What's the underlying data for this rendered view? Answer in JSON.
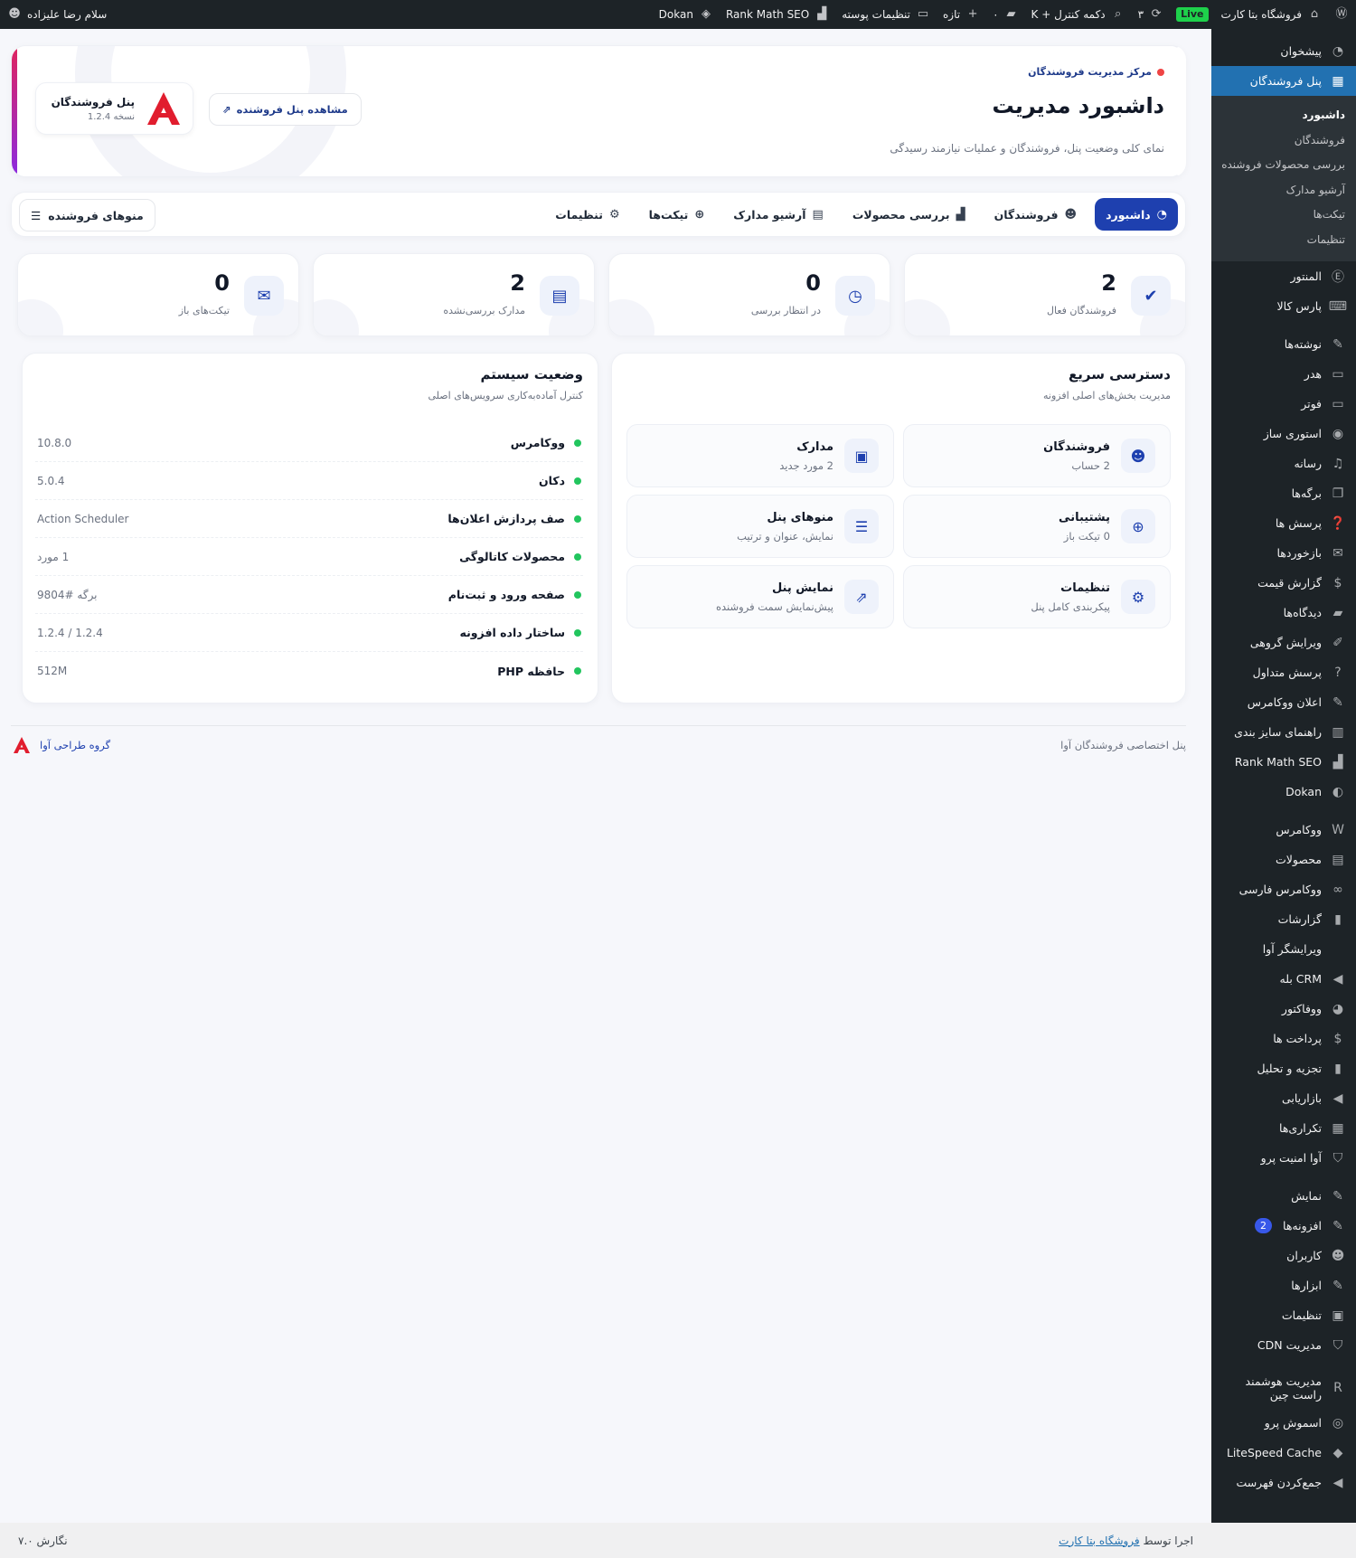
{
  "adminbar": {
    "site_name": "فروشگاه بتا کارت",
    "live_badge": "Live",
    "updates_count": "۳",
    "shortcut": "دکمه کنترل + K",
    "comments_count": "۰",
    "new_label": "تازه",
    "skin_settings": "تنظیمات پوسته",
    "rankmath": "Rank Math SEO",
    "dokan": "Dokan",
    "greeting": "سلام رضا علیزاده"
  },
  "sidebar": {
    "items_top": [
      {
        "label": "پیشخوان",
        "icon": "dashboard-icon",
        "glyph": "◔"
      },
      {
        "label": "پنل فروشندگان",
        "icon": "store-icon",
        "glyph": "▦"
      }
    ],
    "submenu": [
      "داشبورد",
      "فروشندگان",
      "بررسی محصولات فروشنده",
      "آرشیو مدارک",
      "تیکت‌ها",
      "تنظیمات"
    ],
    "items": [
      {
        "label": "المنتور",
        "icon": "elementor-icon",
        "glyph": "Ⓔ",
        "sep": false
      },
      {
        "label": "پارس کالا",
        "icon": "pars-kala-icon",
        "glyph": "⌨",
        "sep": false
      },
      {
        "label": "نوشته‌ها",
        "icon": "pin-icon",
        "glyph": "✎",
        "sep": true
      },
      {
        "label": "هدر",
        "icon": "header-icon",
        "glyph": "▭",
        "sep": false
      },
      {
        "label": "فوتر",
        "icon": "footer-icon",
        "glyph": "▭",
        "sep": false
      },
      {
        "label": "استوری ساز",
        "icon": "story-icon",
        "glyph": "◉",
        "sep": false
      },
      {
        "label": "رسانه",
        "icon": "media-icon",
        "glyph": "♫",
        "sep": false
      },
      {
        "label": "برگه‌ها",
        "icon": "pages-icon",
        "glyph": "❐",
        "sep": false
      },
      {
        "label": "پرسش ها",
        "icon": "questions-icon",
        "glyph": "❓",
        "sep": false
      },
      {
        "label": "بازخوردها",
        "icon": "feedback-icon",
        "glyph": "✉",
        "sep": false
      },
      {
        "label": "گزارش قیمت",
        "icon": "price-report-icon",
        "glyph": "$",
        "sep": false
      },
      {
        "label": "دیدگاه‌ها",
        "icon": "comments-icon",
        "glyph": "▰",
        "sep": false
      },
      {
        "label": "ویرایش گروهی",
        "icon": "bulk-edit-icon",
        "glyph": "✐",
        "sep": false
      },
      {
        "label": "پرسش متداول",
        "icon": "faq-icon",
        "glyph": "?",
        "sep": false
      },
      {
        "label": "اعلان ووکامرس",
        "icon": "notify-icon",
        "glyph": "✎",
        "sep": false
      },
      {
        "label": "راهنمای سایز بندی",
        "icon": "size-guide-icon",
        "glyph": "▥",
        "sep": false
      },
      {
        "label": "Rank Math SEO",
        "icon": "rankmath-icon",
        "glyph": "▟",
        "sep": false
      },
      {
        "label": "Dokan",
        "icon": "dokan-icon",
        "glyph": "◐",
        "sep": false
      },
      {
        "label": "ووکامرس",
        "icon": "woocommerce-icon",
        "glyph": "W",
        "sep": true
      },
      {
        "label": "محصولات",
        "icon": "products-icon",
        "glyph": "▤",
        "sep": false
      },
      {
        "label": "ووکامرس فارسی",
        "icon": "woo-persian-icon",
        "glyph": "∞",
        "sep": false
      },
      {
        "label": "گزارشات",
        "icon": "reports-icon",
        "glyph": "▮",
        "sep": false
      },
      {
        "label": "ویرایشگر آوا",
        "icon": "ava-editor-icon",
        "glyph": "",
        "sep": false
      },
      {
        "label": "CRM بله",
        "icon": "crm-icon",
        "glyph": "◀",
        "sep": false
      },
      {
        "label": "ووفاکتور",
        "icon": "woofactor-icon",
        "glyph": "◕",
        "sep": false
      },
      {
        "label": "پرداخت ها",
        "icon": "payments-icon",
        "glyph": "$",
        "sep": false
      },
      {
        "label": "تجزیه و تحلیل",
        "icon": "analytics-icon",
        "glyph": "▮",
        "sep": false
      },
      {
        "label": "بازاریابی",
        "icon": "marketing-icon",
        "glyph": "◀",
        "sep": false
      },
      {
        "label": "تکراری‌ها",
        "icon": "duplicates-icon",
        "glyph": "▦",
        "sep": false
      },
      {
        "label": "آوا امنیت پرو",
        "icon": "security-icon",
        "glyph": "⛉",
        "sep": false
      },
      {
        "label": "نمایش",
        "icon": "appearance-icon",
        "glyph": "✎",
        "sep": true
      },
      {
        "label": "افزونه‌ها",
        "icon": "plugins-icon",
        "glyph": "✎",
        "sep": false,
        "badge": "2"
      },
      {
        "label": "کاربران",
        "icon": "users-icon",
        "glyph": "☻",
        "sep": false
      },
      {
        "label": "ابزارها",
        "icon": "tools-icon",
        "glyph": "✎",
        "sep": false
      },
      {
        "label": "تنظیمات",
        "icon": "settings-icon",
        "glyph": "▣",
        "sep": false
      },
      {
        "label": "مدیریت CDN",
        "icon": "cdn-icon",
        "glyph": "⛉",
        "sep": false
      },
      {
        "label": "مدیریت هوشمند راست چین",
        "icon": "rtl-theme-icon",
        "glyph": "R",
        "sep": true
      },
      {
        "label": "اسموش پرو",
        "icon": "smush-icon",
        "glyph": "◎",
        "sep": false
      },
      {
        "label": "LiteSpeed Cache",
        "icon": "litespeed-icon",
        "glyph": "◆",
        "sep": false
      },
      {
        "label": "جمع‌کردن فهرست",
        "icon": "collapse-icon",
        "glyph": "◀",
        "sep": false
      }
    ]
  },
  "hero": {
    "crumb": "مرکز مدیریت فروشندگان",
    "title": "داشبورد مدیریت",
    "desc": "نمای کلی وضعیت پنل، فروشندگان و عملیات نیازمند رسیدگی",
    "view_panel": "مشاهده پنل فروشنده",
    "brand_name": "پنل فروشندگان",
    "brand_version": "نسخه 1.2.4"
  },
  "tabs": [
    {
      "label": "داشبورد",
      "icon": "dashboard-icon",
      "glyph": "◔",
      "active": true
    },
    {
      "label": "فروشندگان",
      "icon": "users-icon",
      "glyph": "☻",
      "active": false
    },
    {
      "label": "بررسی محصولات",
      "icon": "bag-icon",
      "glyph": "▟",
      "active": false
    },
    {
      "label": "آرشیو مدارک",
      "icon": "archive-icon",
      "glyph": "▤",
      "active": false
    },
    {
      "label": "تیکت‌ها",
      "icon": "lifebuoy-icon",
      "glyph": "⊕",
      "active": false
    },
    {
      "label": "تنظیمات",
      "icon": "gear-icon",
      "glyph": "⚙",
      "active": false
    }
  ],
  "vendor_menus": "منوهای فروشنده",
  "stats": [
    {
      "value": "2",
      "label": "فروشندگان فعال",
      "icon": "check-icon",
      "glyph": "✔"
    },
    {
      "value": "0",
      "label": "در انتظار بررسی",
      "icon": "clock-icon",
      "glyph": "◷"
    },
    {
      "value": "2",
      "label": "مدارک بررسی‌نشده",
      "icon": "document-icon",
      "glyph": "▤"
    },
    {
      "value": "0",
      "label": "تیکت‌های باز",
      "icon": "chat-icon",
      "glyph": "✉"
    }
  ],
  "quick_access": {
    "title": "دسترسی سریع",
    "subtitle": "مدیریت بخش‌های اصلی افزونه",
    "items": [
      {
        "title": "فروشندگان",
        "sub": "2 حساب",
        "icon": "users-icon",
        "glyph": "☻"
      },
      {
        "title": "مدارک",
        "sub": "2 مورد جدید",
        "icon": "id-card-icon",
        "glyph": "▣"
      },
      {
        "title": "پشتیبانی",
        "sub": "0 تیکت باز",
        "icon": "lifebuoy-icon",
        "glyph": "⊕"
      },
      {
        "title": "منوهای پنل",
        "sub": "نمایش، عنوان و ترتیب",
        "icon": "menu-icon",
        "glyph": "☰"
      },
      {
        "title": "تنظیمات",
        "sub": "پیکربندی کامل پنل",
        "icon": "gear-icon",
        "glyph": "⚙"
      },
      {
        "title": "نمایش پنل",
        "sub": "پیش‌نمایش سمت فروشنده",
        "icon": "external-link-icon",
        "glyph": "⇗"
      }
    ]
  },
  "system_status": {
    "title": "وضعیت سیستم",
    "subtitle": "کنترل آماده‌به‌کاری سرویس‌های اصلی",
    "rows": [
      {
        "name": "ووکامرس",
        "value": "10.8.0"
      },
      {
        "name": "دکان",
        "value": "5.0.4"
      },
      {
        "name": "صف پردازش اعلان‌ها",
        "value": "Action Scheduler"
      },
      {
        "name": "محصولات کاتالوگی",
        "value": "1 مورد"
      },
      {
        "name": "صفحه ورود و ثبت‌نام",
        "value": "برگه #9804"
      },
      {
        "name": "ساختار داده افزونه",
        "value": "1.2.4 / 1.2.4"
      },
      {
        "name": "حافظه PHP",
        "value": "512M"
      }
    ]
  },
  "panel_footer": {
    "left": "پنل اختصاصی فروشندگان آوا",
    "right": "گروه طراحی آوا"
  },
  "wp_footer": {
    "thanks_prefix": "اجرا توسط",
    "thanks_link": "فروشگاه بتا کارت",
    "version": "نگارش ۷.۰"
  },
  "colors": {
    "accent": "#1e40af",
    "status_ok": "#22c55e",
    "sidebar_active": "#2271b1"
  }
}
